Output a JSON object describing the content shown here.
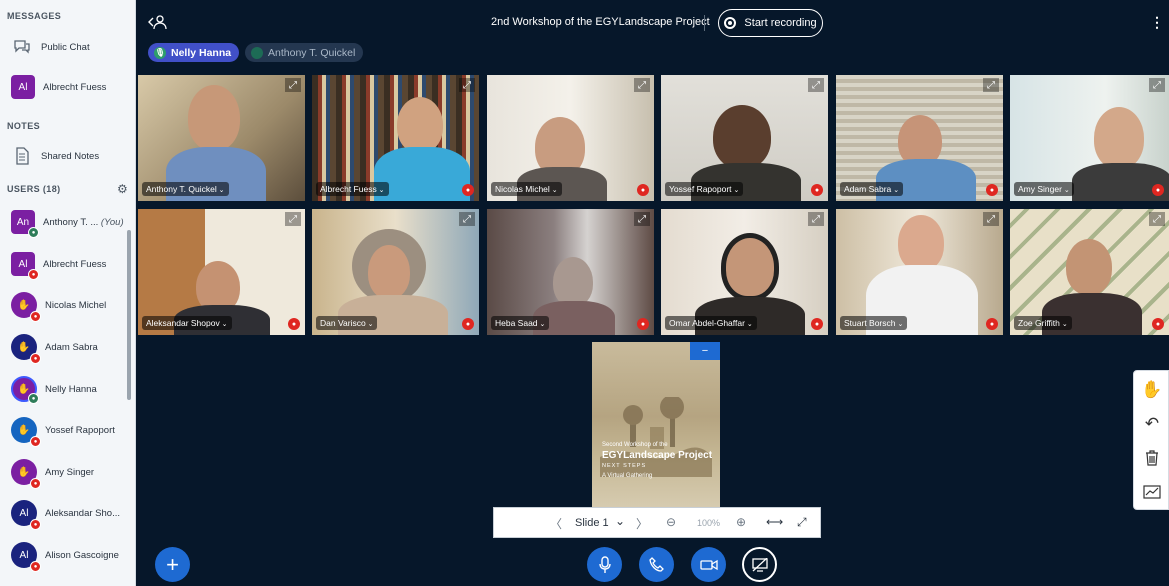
{
  "sidebar": {
    "messages_title": "MESSAGES",
    "public_chat": "Public Chat",
    "private_chat": {
      "initials": "Al",
      "name": "Albrecht Fuess"
    },
    "notes_title": "NOTES",
    "shared_notes": "Shared Notes",
    "users_title": "USERS (18)",
    "users": [
      {
        "initials": "An",
        "name": "Anthony T. ...",
        "you": "(You)"
      },
      {
        "initials": "Al",
        "name": "Albrecht Fuess"
      },
      {
        "name": "Nicolas Michel"
      },
      {
        "name": "Adam Sabra"
      },
      {
        "name": "Nelly Hanna"
      },
      {
        "name": "Yossef Rapoport"
      },
      {
        "name": "Amy Singer"
      },
      {
        "initials": "Al",
        "name": "Aleksandar Sho..."
      },
      {
        "initials": "Al",
        "name": "Alison Gascoigne"
      }
    ]
  },
  "topbar": {
    "title": "2nd Workshop of the EGYLandscape Project",
    "record_label": "Start recording",
    "kebab": "⋮"
  },
  "talkers": [
    {
      "name": "Nelly Hanna"
    },
    {
      "name": "Anthony T. Quickel"
    }
  ],
  "tiles": [
    {
      "name": "Anthony T. Quickel"
    },
    {
      "name": "Albrecht Fuess"
    },
    {
      "name": "Nicolas Michel"
    },
    {
      "name": "Yossef Rapoport"
    },
    {
      "name": "Adam Sabra"
    },
    {
      "name": "Amy Singer"
    },
    {
      "name": "Aleksandar Shopov"
    },
    {
      "name": "Dan Varisco"
    },
    {
      "name": "Heba Saad"
    },
    {
      "name": "Omar Abdel-Ghaffar"
    },
    {
      "name": "Stuart Borsch"
    },
    {
      "name": "Zoe Griffith"
    }
  ],
  "presentation": {
    "minimize": "−",
    "line1": "Second Workshop of the",
    "line2": "EGYLandscape Project",
    "line3": "NEXT STEPS",
    "line4": "A Virtual Gathering",
    "slide_label": "Slide 1",
    "zoom": "100%"
  }
}
